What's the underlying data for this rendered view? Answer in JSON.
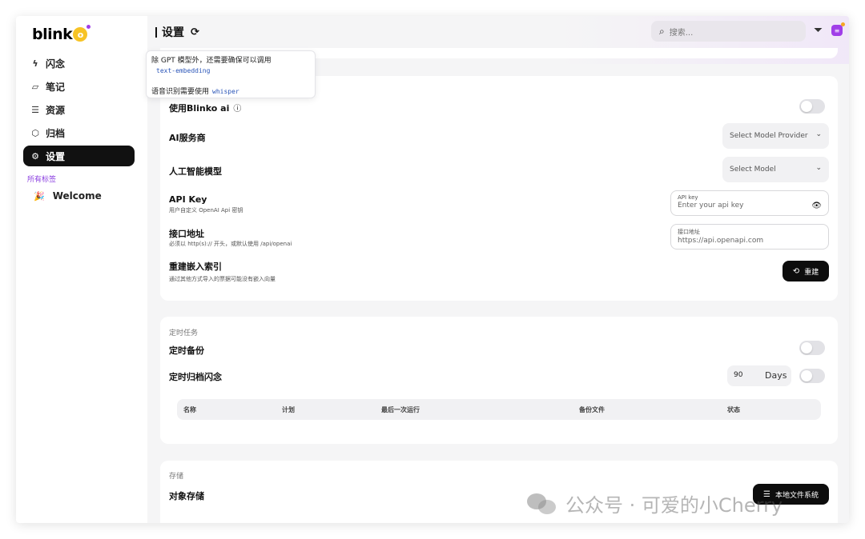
{
  "sidebar": {
    "logo": "blink",
    "logo_o": "o",
    "items": [
      {
        "label": "闪念",
        "icon": "flash-icon"
      },
      {
        "label": "笔记",
        "icon": "notes-icon"
      },
      {
        "label": "资源",
        "icon": "database-icon"
      },
      {
        "label": "归档",
        "icon": "archive-box-icon"
      },
      {
        "label": "设置",
        "icon": "gear-icon"
      }
    ],
    "tags_title": "所有标签",
    "tags": [
      {
        "label": "Welcome",
        "icon": "party-popper-icon"
      }
    ]
  },
  "header": {
    "title": "设置",
    "search_placeholder": "搜索..."
  },
  "tooltip": {
    "line1": "除 GPT 模型外，还需要确保可以调用",
    "code1": "text-embedding",
    "line2": "语音识别需要使用",
    "code2": "whisper"
  },
  "ai": {
    "use_blinko_ai": "使用Blinko ai",
    "provider_label": "AI服务商",
    "provider_select": "Select Model Provider",
    "model_label": "人工智能模型",
    "model_select": "Select Model",
    "api_key_label": "API Key",
    "api_key_desc": "用户自定义 OpenAI Api 密钥",
    "api_key_field_label": "API key",
    "api_key_placeholder": "Enter your api key",
    "endpoint_label": "接口地址",
    "endpoint_desc": "必须以 http(s):// 开头，或默认使用 /api/openai",
    "endpoint_field_label": "接口地址",
    "endpoint_placeholder": "https://api.openapi.com",
    "reindex_label": "重建嵌入索引",
    "reindex_desc": "通过其他方式导入的票据可能没有嵌入向量",
    "reindex_button": "重建"
  },
  "schedule": {
    "section": "定时任务",
    "backup_label": "定时备份",
    "archive_label": "定时归档闪念",
    "days_value": "90",
    "days_unit": "Days",
    "columns": [
      "名称",
      "计划",
      "最后一次运行",
      "备份文件",
      "状态"
    ]
  },
  "storage": {
    "section": "存储",
    "object_storage_label": "对象存储",
    "local_fs_button": "本地文件系统"
  },
  "watermark": "公众号 · 可爱的小Cherry"
}
